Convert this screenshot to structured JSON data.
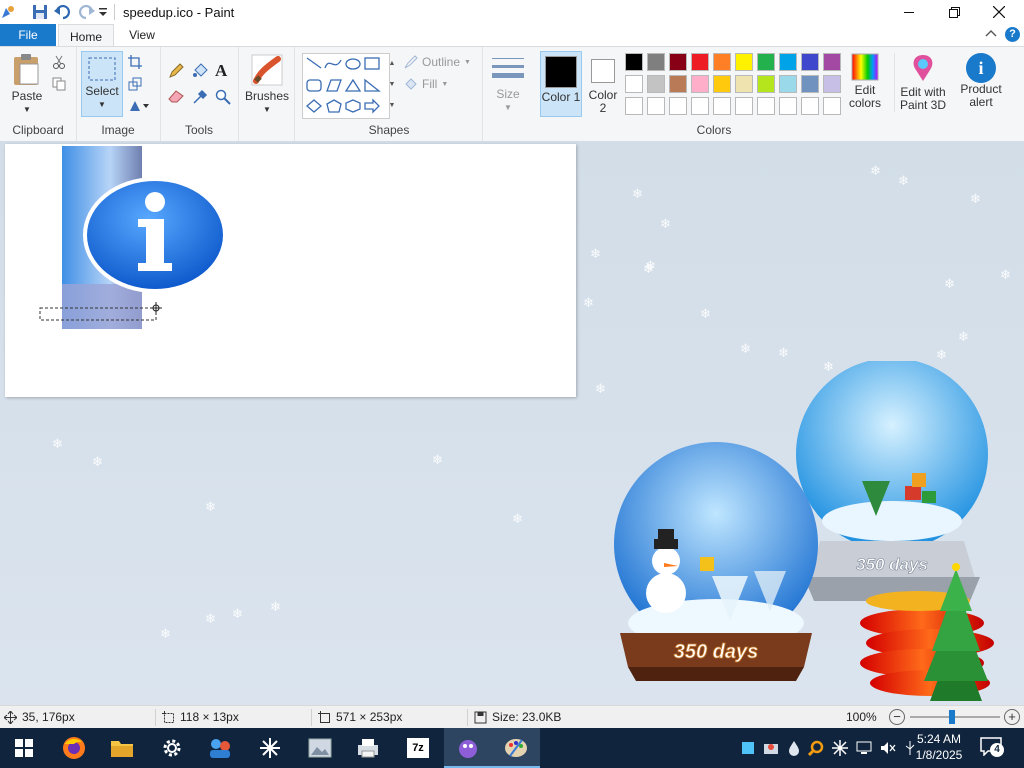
{
  "window": {
    "title": "speedup.ico - Paint"
  },
  "menu": {
    "file": "File",
    "tabs": [
      "Home",
      "View"
    ]
  },
  "ribbon": {
    "clipboard": {
      "label": "Clipboard",
      "paste": "Paste"
    },
    "image": {
      "label": "Image",
      "select": "Select"
    },
    "tools": {
      "label": "Tools"
    },
    "brushes": "Brushes",
    "shapes": {
      "label": "Shapes",
      "outline": "Outline",
      "fill": "Fill"
    },
    "size": "Size",
    "color1": "Color 1",
    "color2": "Color 2",
    "colors": {
      "label": "Colors",
      "edit": "Edit colors"
    },
    "paint3d": "Edit with Paint 3D",
    "product_alert": "Product alert"
  },
  "palette": {
    "row1": [
      "#000000",
      "#7f7f7f",
      "#880015",
      "#ed1c24",
      "#ff7f27",
      "#fff200",
      "#22b14c",
      "#00a2e8",
      "#3f48cc",
      "#a349a4"
    ],
    "row2": [
      "#ffffff",
      "#c3c3c3",
      "#b97a57",
      "#ffaec9",
      "#ffc90e",
      "#efe4b0",
      "#b5e61d",
      "#99d9ea",
      "#7092be",
      "#c8bfe7"
    ],
    "row3": [
      "",
      "",
      "",
      "",
      "",
      "",
      "",
      "",
      "",
      ""
    ]
  },
  "colors_main": {
    "color1": "#000000",
    "color2": "#ffffff"
  },
  "status": {
    "cursor_pos": "35, 176px",
    "selection_size": "118 × 13px",
    "image_size": "571 × 253px",
    "file_size": "Size: 23.0KB",
    "zoom": "100%"
  },
  "desktop": {
    "globe_label": "350 days"
  },
  "taskbar": {
    "apps": [
      "start",
      "firefox",
      "file-explorer",
      "settings",
      "network-people",
      "asterisk-app",
      "photo-viewer",
      "printer-app",
      "7zip",
      "purple-app",
      "paint"
    ],
    "sevenzip_label": "7z",
    "time": "5:24 AM",
    "date": "1/8/2025",
    "notifications": "4"
  }
}
